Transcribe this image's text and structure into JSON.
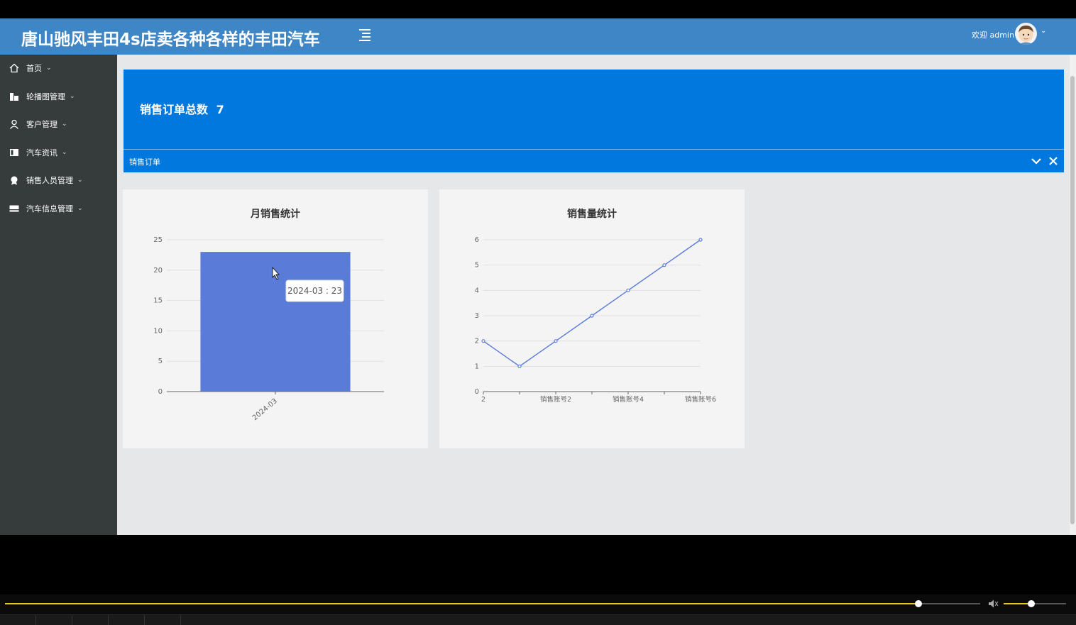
{
  "header": {
    "title": "唐山驰风丰田4s店卖各种各样的丰田汽车",
    "welcome": "欢迎 admin"
  },
  "sidebar": {
    "items": [
      {
        "label": "首页",
        "icon": "home-icon"
      },
      {
        "label": "轮播图管理",
        "icon": "building-icon"
      },
      {
        "label": "客户管理",
        "icon": "user-icon"
      },
      {
        "label": "汽车资讯",
        "icon": "news-icon"
      },
      {
        "label": "销售人员管理",
        "icon": "person-badge-icon"
      },
      {
        "label": "汽车信息管理",
        "icon": "card-icon"
      }
    ]
  },
  "stat": {
    "title": "销售订单总数",
    "count": "7",
    "bar_label": "销售订单"
  },
  "tooltip": "2024-03 : 23",
  "colors": {
    "topbar": "#3f86c7",
    "sidebar": "#363b3c",
    "panel": "#0078de",
    "series": "#5b7bd9",
    "progress": "#e7c51c"
  },
  "player": {
    "progress": 0.937,
    "volume": 0.44
  },
  "chart_data": [
    {
      "type": "bar",
      "title": "月销售统计",
      "categories": [
        "2024-03"
      ],
      "values": [
        23
      ],
      "ylim": [
        0,
        25
      ],
      "yticks": [
        0,
        5,
        10,
        15,
        20,
        25
      ],
      "grid": true
    },
    {
      "type": "line",
      "title": "销售量统计",
      "categories": [
        "2",
        "",
        "销售账号2",
        "",
        "销售账号4",
        "",
        "销售账号6"
      ],
      "values": [
        2,
        1,
        2,
        3,
        4,
        5,
        6
      ],
      "ylim": [
        0,
        6
      ],
      "yticks": [
        0,
        1,
        2,
        3,
        4,
        5,
        6
      ],
      "grid": true
    }
  ]
}
